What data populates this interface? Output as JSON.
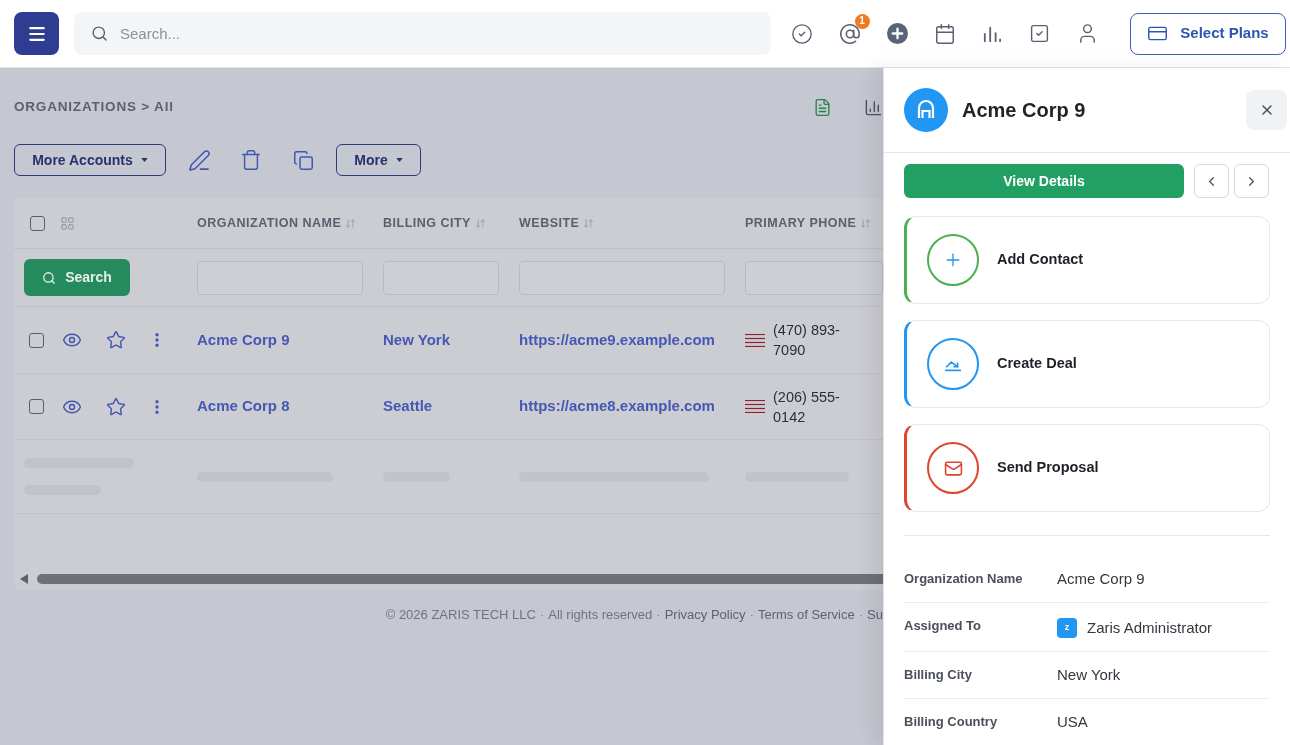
{
  "top_bar": {
    "search": {
      "placeholder": "Search..."
    },
    "mentions_badge": "1",
    "plans_button": "Select Plans"
  },
  "breadcrumb": "ORGANIZATIONS > All",
  "toolbar": {
    "more_accounts": "More Accounts",
    "more": "More"
  },
  "table": {
    "select_all_checked": false,
    "columns": [
      "ORGANIZATION NAME",
      "BILLING CITY",
      "WEBSITE",
      "PRIMARY PHONE"
    ],
    "search_button": "Search",
    "rows": [
      {
        "checked": false,
        "starred": false,
        "organization_name": "Acme Corp 9",
        "billing_city": "New York",
        "website": "https://acme9.example.com",
        "primary_phone": "(470) 893-7090"
      },
      {
        "checked": false,
        "starred": false,
        "organization_name": "Acme Corp 8",
        "billing_city": "Seattle",
        "website": "https://acme8.example.com",
        "primary_phone": "(206) 555-0142"
      }
    ],
    "loading": true
  },
  "footer": [
    {
      "kind": "text",
      "text": "© 2026 ZARIS TECH LLC"
    },
    {
      "kind": "separator",
      "text": "·"
    },
    {
      "kind": "text",
      "text": "All rights reserved"
    },
    {
      "kind": "separator",
      "text": "·"
    },
    {
      "kind": "link",
      "text": "Privacy Policy"
    },
    {
      "kind": "separator",
      "text": "·"
    },
    {
      "kind": "link",
      "text": "Terms of Service"
    },
    {
      "kind": "separator",
      "text": "·"
    },
    {
      "kind": "link",
      "text": "Su"
    }
  ],
  "drawer": {
    "title": "Acme Corp 9",
    "primary_button": "View Details",
    "actions": [
      {
        "kind": "contact",
        "label": "Add Contact",
        "color": "#4caf50"
      },
      {
        "kind": "deal",
        "label": "Create Deal",
        "color": "#2196f3"
      },
      {
        "kind": "proposal",
        "label": "Send Proposal",
        "color": "#e0442f"
      }
    ],
    "details": [
      {
        "kind": "text",
        "label": "Organization Name",
        "value": "Acme Corp 9"
      },
      {
        "kind": "user",
        "label": "Assigned To",
        "avatar": "z",
        "value": "Zaris Administrator"
      },
      {
        "kind": "text",
        "label": "Billing City",
        "value": "New York"
      },
      {
        "kind": "text",
        "label": "Billing Country",
        "value": "USA"
      }
    ]
  }
}
